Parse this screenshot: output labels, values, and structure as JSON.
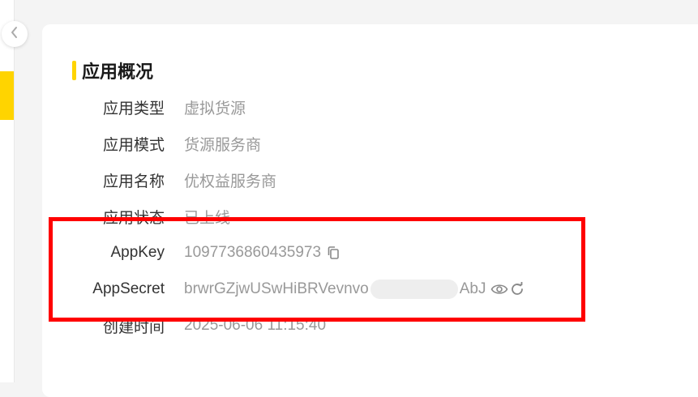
{
  "overview": {
    "title": "应用概况",
    "app_type": {
      "label": "应用类型",
      "value": "虚拟货源"
    },
    "app_mode": {
      "label": "应用模式",
      "value": "货源服务商"
    },
    "app_name": {
      "label": "应用名称",
      "value": "优权益服务商"
    },
    "app_status": {
      "label": "应用状态",
      "value": "已上线"
    },
    "app_key": {
      "label": "AppKey",
      "value": "1097736860435973"
    },
    "app_secret": {
      "label": "AppSecret",
      "value_prefix": "brwrGZjwUSwHiBRVevnvo",
      "value_suffix": "AbJ"
    },
    "created_time": {
      "label": "创建时间",
      "value": "2025-06-06 11:15:40"
    }
  },
  "colors": {
    "accent": "#ffd400",
    "highlight": "#ff0000"
  },
  "icons": {
    "collapse": "chevron-left-icon",
    "copy": "copy-icon",
    "view": "eye-icon",
    "refresh": "refresh-icon"
  }
}
